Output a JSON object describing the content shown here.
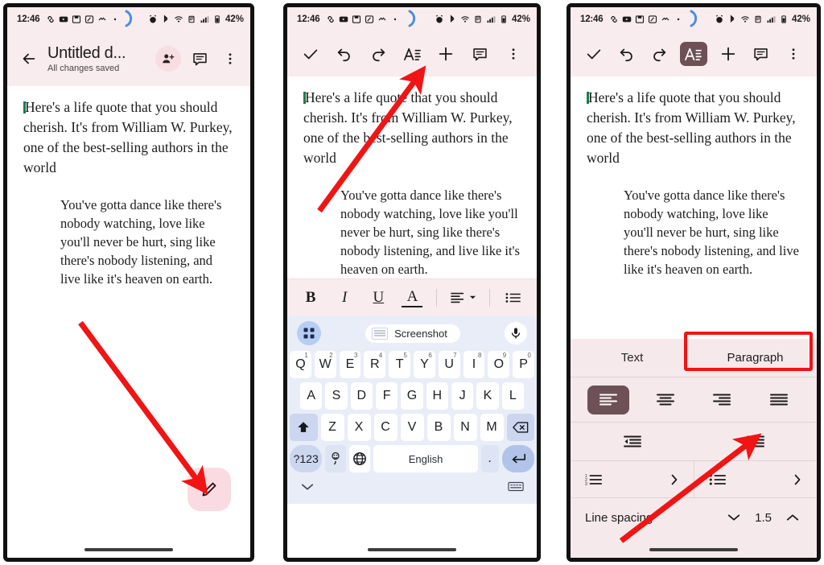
{
  "status_bar": {
    "time": "12:46",
    "battery": "42%",
    "icons": [
      "link-icon",
      "youtube-icon",
      "save-icon",
      "app-icon",
      "keyboard-icon",
      "dot-icon"
    ],
    "right_icons": [
      "alarm-icon",
      "bluetooth-icon",
      "wifi-icon",
      "vpn-icon",
      "signal-icon",
      "battery-icon"
    ]
  },
  "panel1": {
    "header": {
      "back_icon": "back-arrow-icon",
      "title": "Untitled d...",
      "subtitle": "All changes saved",
      "share_icon": "person-add-icon",
      "comment_icon": "comment-icon",
      "more_icon": "more-vert-icon"
    },
    "fab_label": "edit-pencil-icon"
  },
  "document": {
    "paragraph1": "Here's a life quote that you should cherish. It's from William W. Purkey, one of the best-selling authors in the world",
    "paragraph2": "You've gotta dance like there's nobody watching, love like you'll never be hurt, sing like there's nobody listening, and live like it's heaven on earth."
  },
  "edit_toolbar": {
    "buttons": [
      {
        "name": "done-check-icon",
        "label": "✓"
      },
      {
        "name": "undo-icon",
        "label": "↶"
      },
      {
        "name": "redo-icon",
        "label": "↷"
      },
      {
        "name": "format-text-icon",
        "label": "A"
      },
      {
        "name": "insert-plus-icon",
        "label": "+"
      },
      {
        "name": "comment-icon",
        "label": "⌸"
      },
      {
        "name": "more-vert-icon",
        "label": "⋮"
      }
    ]
  },
  "format_bar": {
    "bold": "B",
    "italic": "I",
    "underline": "U",
    "text_color": "A",
    "align": "align-left-icon",
    "list": "bullet-list-icon"
  },
  "keyboard": {
    "suggestion": {
      "apps_icon": "grid-apps-icon",
      "clipboard_chip": "Screenshot",
      "mic_icon": "microphone-icon"
    },
    "row1": [
      {
        "k": "Q",
        "n": "1"
      },
      {
        "k": "W",
        "n": "2"
      },
      {
        "k": "E",
        "n": "3"
      },
      {
        "k": "R",
        "n": "4"
      },
      {
        "k": "T",
        "n": "5"
      },
      {
        "k": "Y",
        "n": "6"
      },
      {
        "k": "U",
        "n": "7"
      },
      {
        "k": "I",
        "n": "8"
      },
      {
        "k": "O",
        "n": "9"
      },
      {
        "k": "P",
        "n": "0"
      }
    ],
    "row2": [
      "A",
      "S",
      "D",
      "F",
      "G",
      "H",
      "J",
      "K",
      "L"
    ],
    "row3": {
      "shift": "shift-up-icon",
      "keys": [
        "Z",
        "X",
        "C",
        "V",
        "B",
        "N",
        "M"
      ],
      "backspace": "backspace-icon"
    },
    "row4": {
      "numbers": "?123",
      "emoji": "emoji-comma-key",
      "globe": "globe-language-icon",
      "space": "English",
      "period": ".",
      "enter": "enter-return-icon"
    },
    "bottom": {
      "hide": "chevron-down-icon",
      "switch": "keyboard-switch-icon"
    }
  },
  "format_panel": {
    "tabs": [
      {
        "label": "Text",
        "active": false
      },
      {
        "label": "Paragraph",
        "active": true
      }
    ],
    "alignment": [
      {
        "name": "align-left-icon",
        "selected": true
      },
      {
        "name": "align-center-icon",
        "selected": false
      },
      {
        "name": "align-right-icon",
        "selected": false
      },
      {
        "name": "align-justify-icon",
        "selected": false
      }
    ],
    "indent": [
      {
        "name": "decrease-indent-icon"
      },
      {
        "name": "increase-indent-icon"
      }
    ],
    "lists": [
      {
        "name": "numbered-list-icon",
        "chevron": "chevron-right-icon"
      },
      {
        "name": "bullet-list-icon",
        "chevron": "chevron-right-icon"
      }
    ],
    "line_spacing": {
      "label": "Line spacing",
      "decrease": "chevron-down-icon",
      "value": "1.5",
      "increase": "chevron-up-icon"
    }
  },
  "annotations": {
    "accent_color": "#f11414",
    "arrow1": "arrow-to-fab",
    "arrow2": "arrow-to-format-icon",
    "arrow3": "arrow-to-increase-indent",
    "highlight_box": "paragraph-tab-highlight"
  },
  "colors": {
    "header_pink": "#f9ecee",
    "panel_pink": "#f6e9eb",
    "selected_mauve": "#6d5157",
    "fab_pink": "#fadbe2",
    "keyboard_blue": "#e9edf8",
    "annotation_red": "#f11414"
  }
}
